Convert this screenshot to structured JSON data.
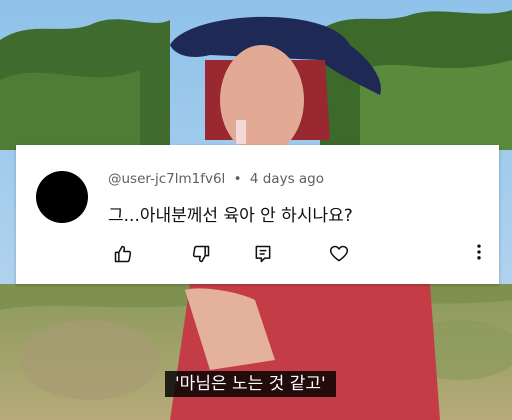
{
  "comment": {
    "username": "@user-jc7lm1fv6l",
    "separator": "•",
    "time": "4 days ago",
    "text": "그...아내분께선 육아 안 하시나요?"
  },
  "actions": {
    "like_icon": "thumbs-up-icon",
    "dislike_icon": "thumbs-down-icon",
    "reply_icon": "reply-icon",
    "heart_icon": "heart-icon",
    "more_icon": "more-vertical-icon"
  },
  "caption": {
    "text": "'마님은 노는 것 같고'"
  },
  "colors": {
    "card_bg": "#ffffff",
    "meta_text": "#606060",
    "body_text": "#0f0f0f",
    "caption_bg": "#000000"
  }
}
